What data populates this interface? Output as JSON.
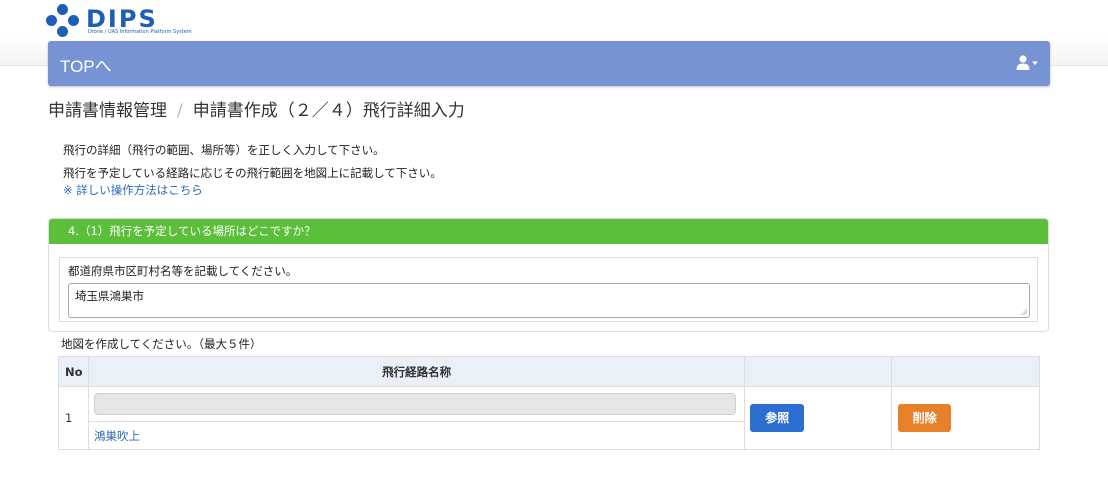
{
  "logo": {
    "text": "DIPS",
    "subtitle": "Drone / UAS Information Platform System"
  },
  "navbar": {
    "top_link": "TOPへ",
    "user_icon": "user-icon",
    "caret_icon": "caret-down-icon"
  },
  "breadcrumb": {
    "items": [
      "申請書情報管理",
      "申請書作成（２／４）飛行詳細入力"
    ],
    "separator": "/"
  },
  "intro": {
    "line1": "飛行の詳細（飛行の範囲、場所等）を正しく入力して下さい。",
    "line2": "飛行を予定している経路に応じその飛行範囲を地図上に記載して下さい。",
    "help_link": "※ 詳しい操作方法はこちら"
  },
  "location_panel": {
    "heading": "4.（1）飛行を予定している場所はどこですか？",
    "field_label": "都道府県市区町村名等を記載してください。",
    "field_value": "埼玉県鴻巣市"
  },
  "map_section": {
    "caption": "地図を作成してください。（最大５件）",
    "columns": [
      "No",
      "飛行経路名称",
      "",
      ""
    ],
    "rows": [
      {
        "no": "1",
        "route_name": "鴻巣吹上",
        "ref_label": "参照",
        "delete_label": "削除"
      }
    ]
  },
  "colors": {
    "navbar": "#7893d4",
    "panel_header": "#5cbf3c",
    "ref_button": "#2d6fd1",
    "delete_button": "#e6812a",
    "link": "#2a6ab5"
  }
}
